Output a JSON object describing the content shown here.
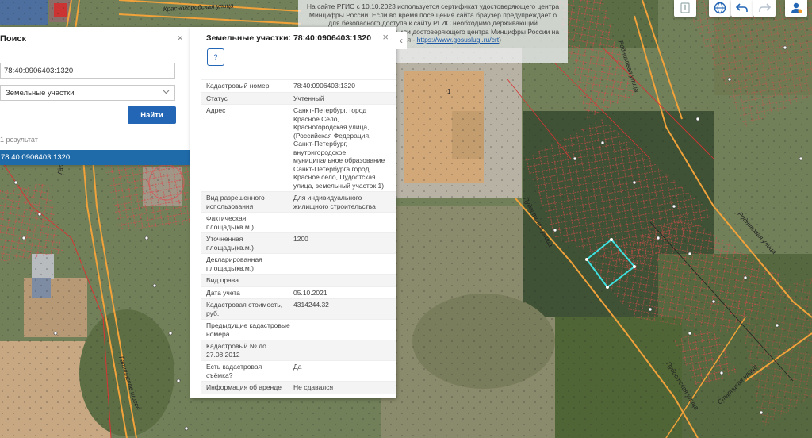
{
  "map": {
    "streets": [
      "Красногородская улица",
      "Родниковая улица",
      "Пудостская улица",
      "Пудостская улица",
      "Гатчинское шоссе",
      "Гатчинское шоссе",
      "Родниковая улица",
      "Старицкая улица"
    ],
    "parcel_number": "1"
  },
  "notice": {
    "text": "На сайте РГИС с 10.10.2023 используется сертификат удостоверяющего центра Минцифры России. Если во время посещения сайта браузер предупреждает о для безопасного доступа к сайту РГИС необходимо держивающий отечественные сертификаты или достоверяющего центра Минцифры России на ваше струкция - ",
    "link": "https://www.gosuslugi.ru/crt",
    "tail": ")"
  },
  "toolbar": {
    "items": [
      {
        "name": "info-icon"
      },
      {
        "name": "globe-icon"
      },
      {
        "name": "undo-icon"
      },
      {
        "name": "redo-icon"
      },
      {
        "name": "user-icon"
      }
    ]
  },
  "search": {
    "title": "Поиск",
    "close": "×",
    "query": "78:40:0906403:1320",
    "type": "Земельные участки",
    "button": "Найти",
    "count": "1 результат",
    "results": [
      "78:40:0906403:1320"
    ]
  },
  "card": {
    "title": "Земельные участки: 78:40:0906403:1320",
    "close": "×",
    "collapse": "‹",
    "question_icon": "?",
    "rows": [
      {
        "label": "Кадастровый номер",
        "value": "78:40:0906403:1320"
      },
      {
        "label": "Статус",
        "value": "Учтенный"
      },
      {
        "label": "Адрес",
        "value": "Санкт-Петербург, город Красное Село, Красногородская улица, (Российская Федерация, Санкт-Петербург, внутригородское муниципальное образование Санкт-Петербурга город Красное село, Пудостская улица, земельный участок 1)"
      },
      {
        "label": "Вид разрешенного использования",
        "value": "Для индивидуального жилищного строительства"
      },
      {
        "label": "Фактическая площадь(кв.м.)",
        "value": ""
      },
      {
        "label": "Уточненная площадь(кв.м.)",
        "value": "1200"
      },
      {
        "label": "Декларированная площадь(кв.м.)",
        "value": ""
      },
      {
        "label": "Вид права",
        "value": ""
      },
      {
        "label": "Дата учета",
        "value": "05.10.2021"
      },
      {
        "label": "Кадастровая стоимость, руб.",
        "value": "4314244.32"
      },
      {
        "label": "Предыдущие кадастровые номера",
        "value": ""
      },
      {
        "label": "Кадастровый № до 27.08.2012",
        "value": ""
      },
      {
        "label": "Есть кадастровая съёмка?",
        "value": "Да"
      },
      {
        "label": "Информация об аренде",
        "value": "Не сдавался"
      }
    ]
  }
}
